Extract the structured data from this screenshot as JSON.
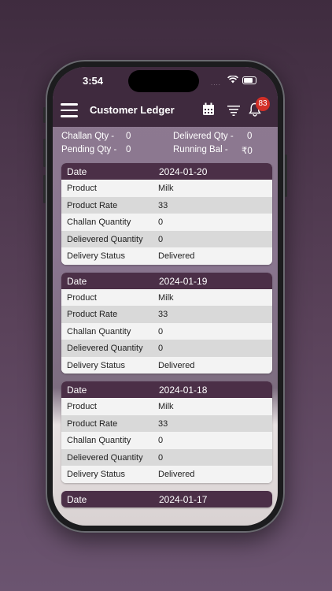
{
  "status_bar": {
    "time": "3:54",
    "signal": "....",
    "wifi_icon": "wifi-icon",
    "battery_icon": "battery-icon"
  },
  "app_bar": {
    "title": "Customer Ledger",
    "menu_icon": "hamburger-menu-icon",
    "calendar_icon": "calendar-icon",
    "filter_icon": "filter-icon",
    "bell_icon": "bell-icon",
    "notification_count": "83"
  },
  "summary": {
    "challan_qty_label": "Challan Qty -",
    "challan_qty_value": "0",
    "delivered_qty_label": "Delivered Qty -",
    "delivered_qty_value": "0",
    "pending_qty_label": "Pending Qty -",
    "pending_qty_value": "0",
    "running_bal_label": "Running Bal -",
    "running_bal_value": "₹0"
  },
  "labels": {
    "date": "Date",
    "product": "Product",
    "product_rate": "Product Rate",
    "challan_quantity": "Challan Quantity",
    "delivered_quantity": "Delievered Quantity",
    "delivery_status": "Delivery Status"
  },
  "entries": [
    {
      "date": "2024-01-20",
      "product": "Milk",
      "product_rate": "33",
      "challan_quantity": "0",
      "delivered_quantity": "0",
      "delivery_status": "Delivered"
    },
    {
      "date": "2024-01-19",
      "product": "Milk",
      "product_rate": "33",
      "challan_quantity": "0",
      "delivered_quantity": "0",
      "delivery_status": "Delivered"
    },
    {
      "date": "2024-01-18",
      "product": "Milk",
      "product_rate": "33",
      "challan_quantity": "0",
      "delivered_quantity": "0",
      "delivery_status": "Delivered"
    },
    {
      "date": "2024-01-17"
    }
  ],
  "colors": {
    "primary": "#3f2a3e",
    "card_header": "#4b2f47",
    "badge": "#d22f27"
  }
}
